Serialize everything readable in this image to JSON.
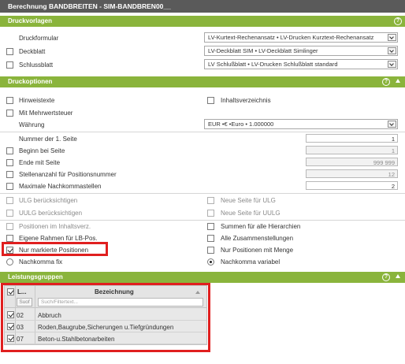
{
  "title": "Berechnung BANDBREITEN - SIM-BANDBREN00__",
  "sections": {
    "druckvorlagen": "Druckvorlagen",
    "druckoptionen": "Druckoptionen",
    "leistungsgruppen": "Leistungsgruppen"
  },
  "druckvorlagen": {
    "druckformular_label": "Druckformular",
    "druckformular_value": "LV-Kurtext-Rechenansatz • LV-Drucken Kurztext-Rechenansatz",
    "deckblatt_label": "Deckblatt",
    "deckblatt_value": "LV-Deckblatt SIM • LV-Deckblatt Simlinger",
    "schlussblatt_label": "Schlussblatt",
    "schlussblatt_value": "LV Schlußblatt • LV-Drucken Schlußblatt standard"
  },
  "druckoptionen": {
    "hinweistexte": "Hinweistexte",
    "inhaltsverzeichnis": "Inhaltsverzeichnis",
    "mit_mehrwertsteuer": "Mit Mehrwertsteuer",
    "waehrung_label": "Währung",
    "waehrung_value": "EUR •€ •Euro • 1.000000",
    "nummer_label": "Nummer der 1. Seite",
    "nummer_value": "1",
    "beginn_label": "Beginn bei Seite",
    "beginn_value": "1",
    "ende_label": "Ende mit Seite",
    "ende_value": "999 999",
    "stellenanzahl_label": "Stellenanzahl für Positionsnummer",
    "stellenanzahl_value": "12",
    "maximale_label": "Maximale Nachkommastellen",
    "maximale_value": "2",
    "ulg": "ULG berücksichtigen",
    "neue_seite_ulg": "Neue Seite für ULG",
    "uulg": "UULG berücksichtigen",
    "neue_seite_uulg": "Neue Seite für UULG",
    "positionen_inhaltsverz": "Positionen im Inhaltsverz.",
    "summen_hierarchien": "Summen für alle Hierarchien",
    "eigene_rahmen": "Eigene Rahmen für LB-Pos.",
    "alle_zusammenstellungen": "Alle Zusammenstellungen",
    "nur_markierte": "Nur markierte Positionen",
    "nur_positionen_menge": "Nur Positionen mit Menge",
    "nachkomma_fix": "Nachkomma fix",
    "nachkomma_variabel": "Nachkomma variabel"
  },
  "leistungsgruppen": {
    "col_lg": "L...",
    "col_bezeichnung": "Bezeichnung",
    "filter_btn": "Suof",
    "filter_placeholder": "Such/Filtertext...",
    "rows": [
      {
        "nr": "02",
        "bezeichnung": "Abbruch"
      },
      {
        "nr": "03",
        "bezeichnung": "Roden,Baugrube,Sicherungen u.Tiefgründungen"
      },
      {
        "nr": "07",
        "bezeichnung": "Beton-u.Stahlbetonarbeiten"
      }
    ]
  }
}
